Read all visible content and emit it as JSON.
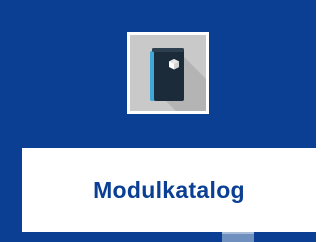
{
  "tile": {
    "label": "Modulkatalog",
    "icon": "book-icon",
    "background_color": "#0a3f93",
    "label_color": "#0a3f93"
  }
}
